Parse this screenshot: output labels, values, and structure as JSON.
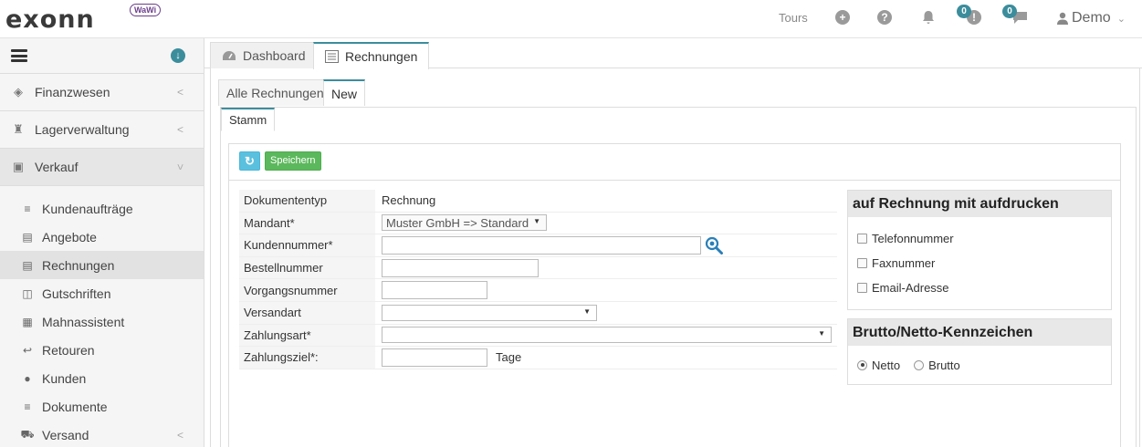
{
  "header": {
    "logo_text": "exonn",
    "logo_badge": "WaWi",
    "tours_label": "Tours",
    "notifications_count": "0",
    "messages_count": "0",
    "user_name": "Demo"
  },
  "sidebar": {
    "sections": [
      {
        "label": "Finanzwesen",
        "icon": "tag-icon"
      },
      {
        "label": "Lagerverwaltung",
        "icon": "warehouse-icon"
      },
      {
        "label": "Verkauf",
        "icon": "cart-icon"
      }
    ],
    "items": [
      {
        "label": "Kundenaufträge",
        "icon": "orders-icon"
      },
      {
        "label": "Angebote",
        "icon": "offers-icon"
      },
      {
        "label": "Rechnungen",
        "icon": "invoice-icon"
      },
      {
        "label": "Gutschriften",
        "icon": "credit-icon"
      },
      {
        "label": "Mahnassistent",
        "icon": "dunning-icon"
      },
      {
        "label": "Retouren",
        "icon": "return-icon"
      },
      {
        "label": "Kunden",
        "icon": "user-icon"
      },
      {
        "label": "Dokumente",
        "icon": "documents-icon"
      },
      {
        "label": "Versand",
        "icon": "truck-icon"
      }
    ]
  },
  "tabs": {
    "main": [
      "Dashboard",
      "Rechnungen"
    ],
    "sub": [
      "Alle Rechnungen",
      "New"
    ],
    "form": "Stamm"
  },
  "toolbar": {
    "save_label": "Speichern"
  },
  "form": {
    "dokumententyp_label": "Dokumententyp",
    "dokumententyp_value": "Rechnung",
    "mandant_label": "Mandant*",
    "mandant_value": "Muster GmbH => Standard",
    "kundennummer_label": "Kundennummer*",
    "bestellnummer_label": "Bestellnummer",
    "vorgangsnummer_label": "Vorgangsnummer",
    "versandart_label": "Versandart",
    "zahlungsart_label": "Zahlungsart*",
    "zahlungsziel_label": "Zahlungsziel*:",
    "zahlungsziel_unit": "Tage"
  },
  "print_box": {
    "title": "auf Rechnung mit aufdrucken",
    "options": [
      "Telefonnummer",
      "Faxnummer",
      "Email-Adresse"
    ]
  },
  "tax_box": {
    "title": "Brutto/Netto-Kennzeichen",
    "options": [
      "Netto",
      "Brutto"
    ],
    "selected": "Netto"
  }
}
